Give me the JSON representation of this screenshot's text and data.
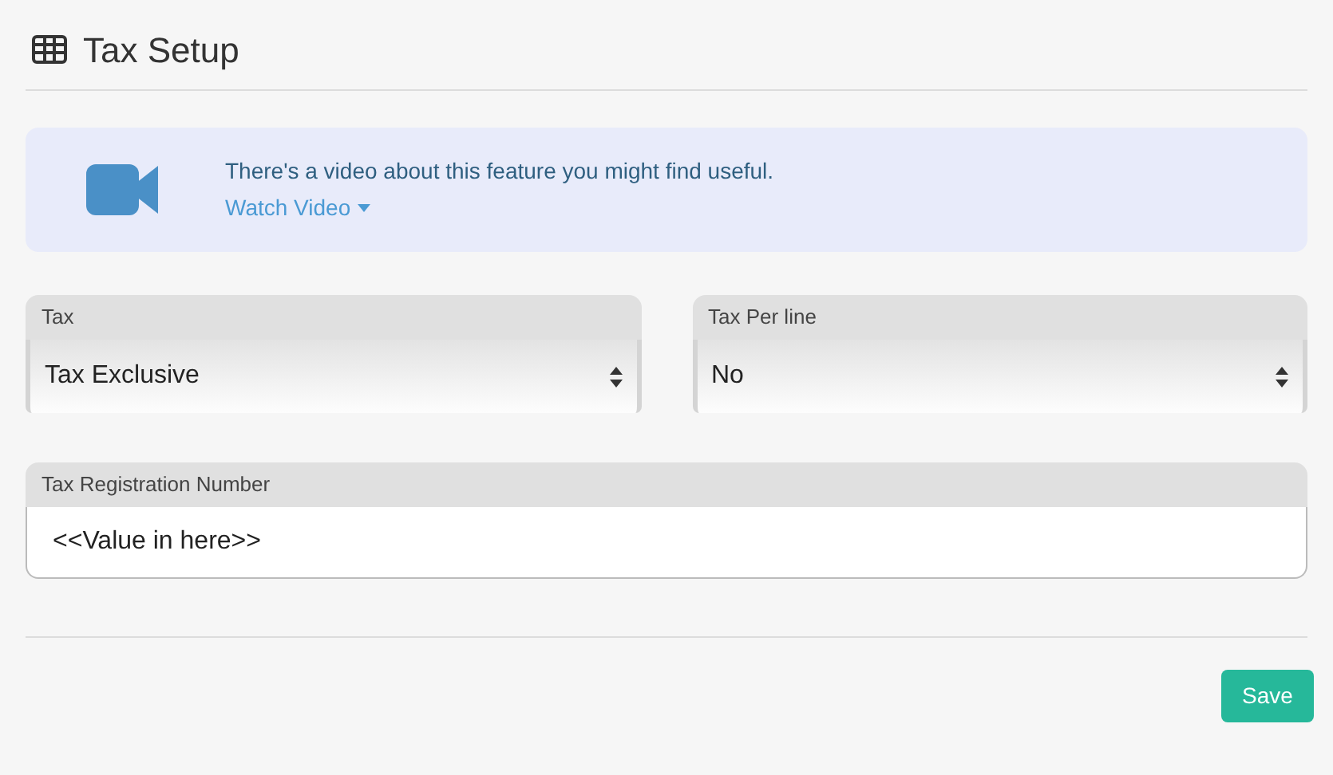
{
  "header": {
    "title": "Tax Setup"
  },
  "video_banner": {
    "message": "There's a video about this feature you might find useful.",
    "link": "Watch Video"
  },
  "fields": [
    {
      "kind": "select",
      "label": "Tax",
      "value": "Tax Exclusive"
    },
    {
      "kind": "select",
      "label": "Tax Per line",
      "value": "No"
    },
    {
      "kind": "text",
      "label": "Tax Registration Number",
      "value": "<<Value in here>>"
    }
  ],
  "buttons": [
    {
      "label": "Save"
    }
  ]
}
